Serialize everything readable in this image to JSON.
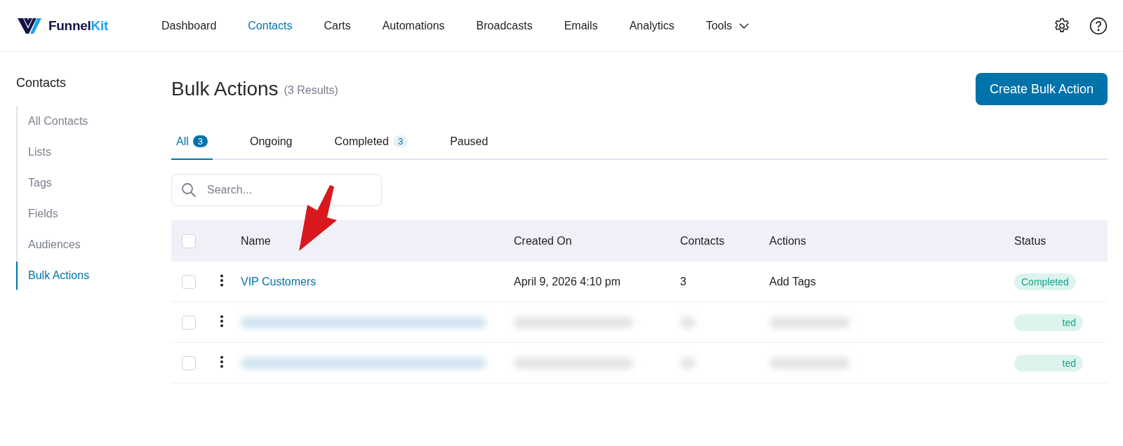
{
  "logo": {
    "text_main": "Funnel",
    "text_accent": "Kit"
  },
  "nav": [
    {
      "label": "Dashboard",
      "selected": false
    },
    {
      "label": "Contacts",
      "selected": true
    },
    {
      "label": "Carts",
      "selected": false
    },
    {
      "label": "Automations",
      "selected": false
    },
    {
      "label": "Broadcasts",
      "selected": false
    },
    {
      "label": "Emails",
      "selected": false
    },
    {
      "label": "Analytics",
      "selected": false
    },
    {
      "label": "Tools",
      "selected": false,
      "dropdown": true
    }
  ],
  "sidebar": {
    "title": "Contacts",
    "items": [
      {
        "label": "All Contacts",
        "selected": false
      },
      {
        "label": "Lists",
        "selected": false
      },
      {
        "label": "Tags",
        "selected": false
      },
      {
        "label": "Fields",
        "selected": false
      },
      {
        "label": "Audiences",
        "selected": false
      },
      {
        "label": "Bulk Actions",
        "selected": true
      }
    ]
  },
  "page": {
    "title": "Bulk Actions",
    "count": "(3 Results)",
    "button": "Create Bulk Action"
  },
  "tabs": [
    {
      "label": "All",
      "badge": "3",
      "selected": true
    },
    {
      "label": "Ongoing",
      "selected": false
    },
    {
      "label": "Completed",
      "badge": "3",
      "selected": false
    },
    {
      "label": "Paused",
      "selected": false
    }
  ],
  "search": {
    "placeholder": "Search..."
  },
  "table": {
    "select_all_checked": false,
    "columns": [
      "Name",
      "Created On",
      "Contacts",
      "Actions",
      "Status"
    ],
    "rows": [
      {
        "kind": "plain",
        "checked": false,
        "name": "VIP Customers",
        "created": "April 9, 2026 4:10 pm",
        "contacts": "3",
        "actions": "Add Tags",
        "status": "Completed"
      },
      {
        "kind": "redacted",
        "checked": false,
        "status": "ted"
      },
      {
        "kind": "redacted",
        "checked": false,
        "status": "ted"
      }
    ]
  }
}
